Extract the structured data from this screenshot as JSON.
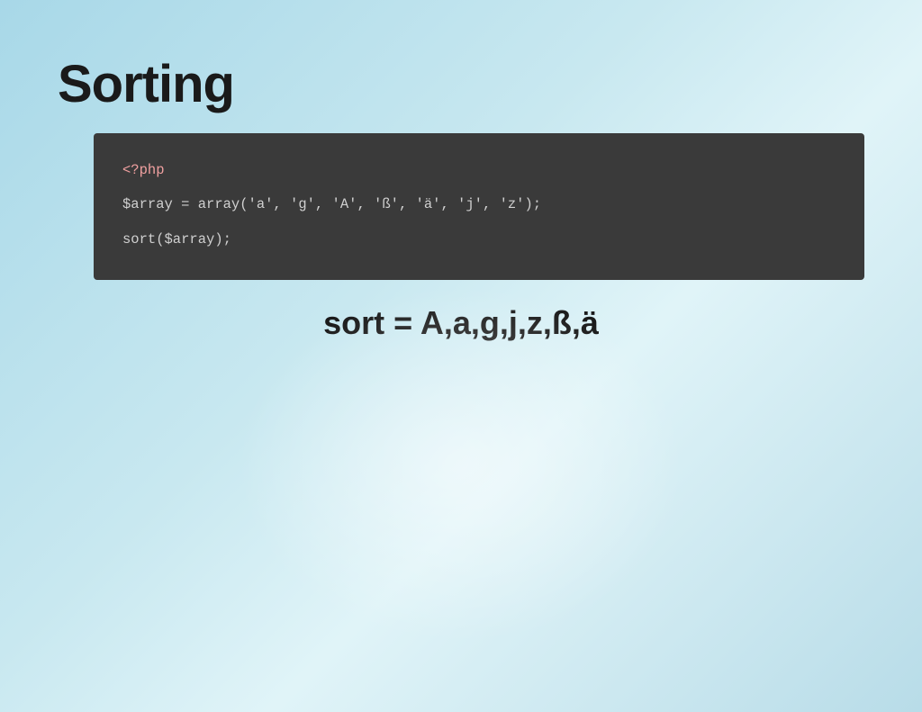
{
  "page": {
    "title": "Sorting",
    "background_gradient": "light blue radial"
  },
  "code_block": {
    "line1": "<?php",
    "line2": "",
    "line3": "$array = array('a', 'g', 'A', 'ß', 'ä', 'j', 'z');",
    "line4": "",
    "line5": "sort($array);"
  },
  "result": {
    "label": "sort = A,a,g,j,z,ß,ä"
  }
}
